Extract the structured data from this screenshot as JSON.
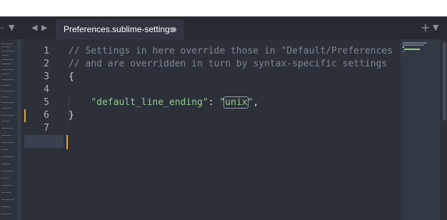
{
  "tabbar": {
    "tab_title": "Preferences.sublime-settings",
    "nav_back": "◀",
    "nav_forward": "▶",
    "left_menu": "▼",
    "new_tab": "+",
    "tab_menu": "▼"
  },
  "editor": {
    "line_numbers": [
      "1",
      "2",
      "3",
      "4",
      "5",
      "6",
      "7"
    ],
    "lines": {
      "l1": "// Settings in here override those in \"Default/Preferences",
      "l2": "// and are overridden in turn by syntax-specific settings",
      "l3": "{",
      "l4": "",
      "l5_key": "\"default_line_ending\"",
      "l5_colon": ": ",
      "l5_q1": "\"",
      "l5_val": "unix",
      "l5_q2": "\"",
      "l5_comma": ",",
      "l6": "}",
      "l7": ""
    },
    "modified_lines": [
      "5",
      "7"
    ],
    "current_line": "7"
  },
  "colors": {
    "background": "#2b3039",
    "comment": "#7d8591",
    "string": "#99c794",
    "caret": "#e8a33d",
    "highlight_border": "#5fb3b3"
  }
}
